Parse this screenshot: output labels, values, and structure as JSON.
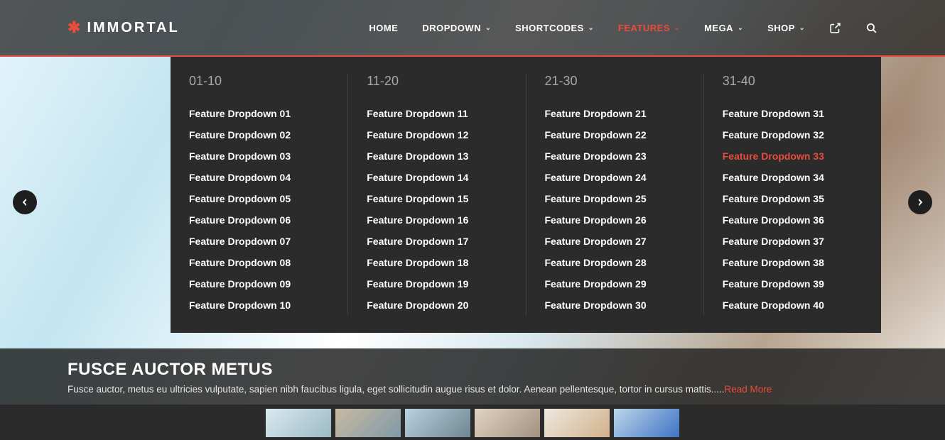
{
  "brand": "IMMORTAL",
  "nav": {
    "home": "HOME",
    "dropdown": "DROPDOWN",
    "shortcodes": "SHORTCODES",
    "features": "FEATURES",
    "mega": "MEGA",
    "shop": "SHOP"
  },
  "mega": {
    "columns": [
      {
        "heading": "01-10",
        "items": [
          "Feature Dropdown 01",
          "Feature Dropdown 02",
          "Feature Dropdown 03",
          "Feature Dropdown 04",
          "Feature Dropdown 05",
          "Feature Dropdown 06",
          "Feature Dropdown 07",
          "Feature Dropdown 08",
          "Feature Dropdown 09",
          "Feature Dropdown 10"
        ]
      },
      {
        "heading": "11-20",
        "items": [
          "Feature Dropdown 11",
          "Feature Dropdown 12",
          "Feature Dropdown 13",
          "Feature Dropdown 14",
          "Feature Dropdown 15",
          "Feature Dropdown 16",
          "Feature Dropdown 17",
          "Feature Dropdown 18",
          "Feature Dropdown 19",
          "Feature Dropdown 20"
        ]
      },
      {
        "heading": "21-30",
        "items": [
          "Feature Dropdown 21",
          "Feature Dropdown 22",
          "Feature Dropdown 23",
          "Feature Dropdown 24",
          "Feature Dropdown 25",
          "Feature Dropdown 26",
          "Feature Dropdown 27",
          "Feature Dropdown 28",
          "Feature Dropdown 29",
          "Feature Dropdown 30"
        ]
      },
      {
        "heading": "31-40",
        "items": [
          "Feature Dropdown 31",
          "Feature Dropdown 32",
          "Feature Dropdown 33",
          "Feature Dropdown 34",
          "Feature Dropdown 35",
          "Feature Dropdown 36",
          "Feature Dropdown 37",
          "Feature Dropdown 38",
          "Feature Dropdown 39",
          "Feature Dropdown 40"
        ]
      }
    ],
    "hovered": "Feature Dropdown 33"
  },
  "caption": {
    "title": "FUSCE AUCTOR METUS",
    "text": "Fusce auctor, metus eu ultricies vulputate, sapien nibh faucibus ligula, eget sollicitudin augue risus et dolor. Aenean pellentesque, tortor in cursus mattis.....",
    "read_more": "Read More"
  }
}
